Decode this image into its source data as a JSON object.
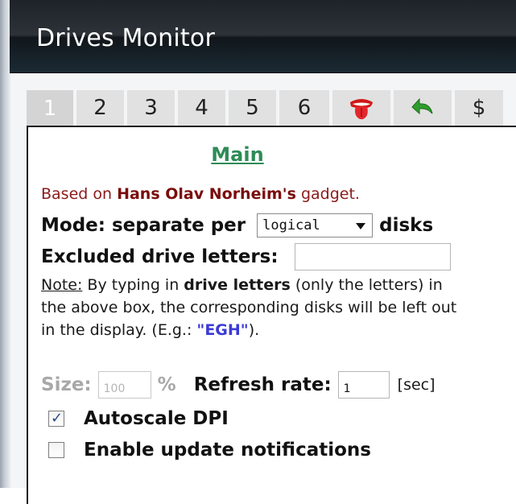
{
  "window": {
    "title": "Drives Monitor"
  },
  "tabs": [
    {
      "label": "1",
      "active": true,
      "icon": null
    },
    {
      "label": "2",
      "active": false,
      "icon": null
    },
    {
      "label": "3",
      "active": false,
      "icon": null
    },
    {
      "label": "4",
      "active": false,
      "icon": null
    },
    {
      "label": "5",
      "active": false,
      "icon": null
    },
    {
      "label": "6",
      "active": false,
      "icon": null
    },
    {
      "label": "",
      "active": false,
      "icon": "tongue-logo-icon"
    },
    {
      "label": "",
      "active": false,
      "icon": "undo-arrow-icon"
    },
    {
      "label": "$",
      "active": false,
      "icon": null
    }
  ],
  "main": {
    "heading": "Main",
    "credit": {
      "prefix": "Based on ",
      "author": "Hans Olav Norheim's",
      "suffix": " gadget."
    },
    "mode": {
      "label_before": "Mode: separate per",
      "selected": "logical",
      "label_after": "disks"
    },
    "excluded": {
      "label": "Excluded drive letters:",
      "value": ""
    },
    "note": {
      "label": "Note:",
      "text1": " By typing in ",
      "bold": "drive letters",
      "text2": " (only the letters) in the above box, the corresponding disks will be left out in the display. (E.g.: ",
      "example": "\"EGH\"",
      "text3": ")."
    },
    "size": {
      "label": "Size:",
      "placeholder": "100",
      "unit": "%"
    },
    "refresh": {
      "label": "Refresh rate:",
      "value": "1",
      "unit": "[sec]"
    },
    "autoscale": {
      "label": "Autoscale DPI",
      "checked": true
    },
    "notifications": {
      "label": "Enable update notifications",
      "checked": false
    }
  },
  "colors": {
    "heading": "#2e8b57",
    "credit": "#8b1a1a",
    "example": "#3b3bd6",
    "disabled": "#a8a8a8"
  }
}
